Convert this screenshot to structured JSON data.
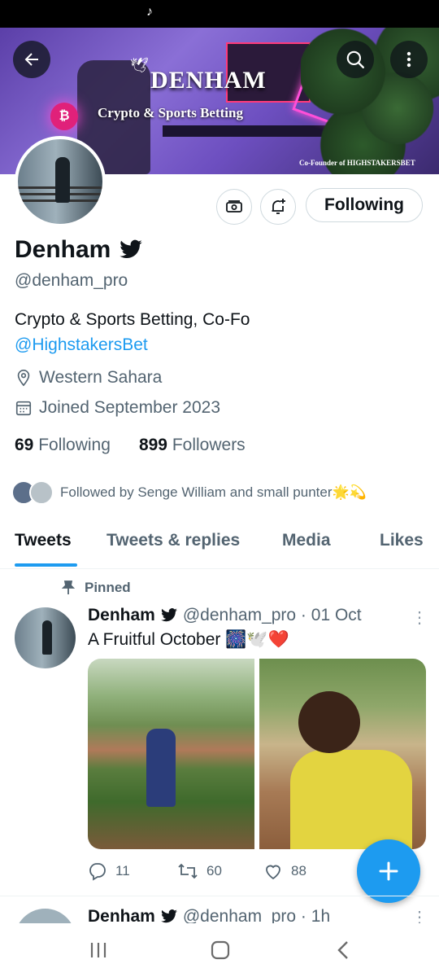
{
  "status_bar": {
    "app_icon": "tiktok-icon"
  },
  "banner": {
    "brand": "DENHAM",
    "tagline": "Crypto & Sports Betting",
    "cofounder": "Co-Founder of HIGHSTAKERSBET",
    "logo_glyph": "₿"
  },
  "profile": {
    "name": "Denham",
    "handle": "@denham_pro",
    "bio_text": "Crypto & Sports Betting, Co-Fo",
    "bio_link": "@HighstakersBet",
    "location": "Western Sahara",
    "joined": "Joined September 2023",
    "following_count": "69",
    "following_label": "Following",
    "followers_count": "899",
    "followers_label": "Followers",
    "followed_by": "Followed by Senge William and small punter🌟💫",
    "follow_button": "Following"
  },
  "tabs": [
    "Tweets",
    "Tweets & replies",
    "Media",
    "Likes"
  ],
  "pinned_tweet": {
    "pinned_label": "Pinned",
    "name": "Denham",
    "handle_time": "@denham_pro · 01 Oct",
    "text": "A Fruitful October 🎆🕊️❤️",
    "replies": "11",
    "retweets": "60",
    "likes": "88"
  },
  "next_tweet": {
    "name": "Denham",
    "handle_time": "@denham_pro · 1h"
  },
  "colors": {
    "accent": "#1d9bf0",
    "text": "#0f1419",
    "secondary": "#536471"
  }
}
